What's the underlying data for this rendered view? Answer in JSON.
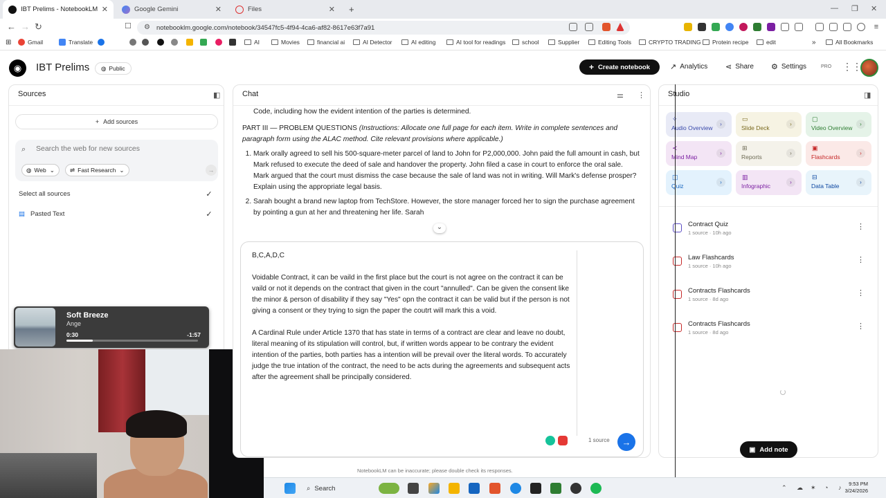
{
  "browser": {
    "tabs": [
      {
        "title": "IBT Prelims - NotebookLM",
        "active": true
      },
      {
        "title": "Google Gemini",
        "active": false
      },
      {
        "title": "Files",
        "active": false
      }
    ],
    "new_tab": "+",
    "url": "notebooklm.google.com/notebook/34547fc5-4f94-4ca6-af82-8617e63f7a91"
  },
  "bookmarks": {
    "items": [
      "Gmail",
      "Translate",
      "AI",
      "Movies",
      "financial ai",
      "AI Detector",
      "AI editing",
      "AI tool for readings",
      "school",
      "Supplier",
      "Editing Tools",
      "CRYPTO TRADING",
      "Protein recipe",
      "edit"
    ],
    "more": "»",
    "all": "All Bookmarks"
  },
  "header": {
    "notebook_title": "IBT Prelims",
    "public_label": "Public",
    "create_label": "Create notebook",
    "analytics_label": "Analytics",
    "share_label": "Share",
    "settings_label": "Settings",
    "pro_label": "PRO"
  },
  "sources": {
    "title": "Sources",
    "add_label": "Add sources",
    "search_placeholder": "Search the web for new sources",
    "web_chip": "Web",
    "research_chip": "Fast Research",
    "select_all": "Select all sources",
    "items": [
      {
        "label": "Pasted Text"
      }
    ]
  },
  "media": {
    "title": "Soft Breeze",
    "artist": "Ange",
    "current": "0:30",
    "remaining": "-1:57",
    "progress": 0.2
  },
  "chat": {
    "title": "Chat",
    "line0": "Code, including how the evident intention of the parties is determined.",
    "part3_heading": "PART III — PROBLEM QUESTIONS",
    "part3_instructions": "(Instructions: Allocate one full page for each item. Write in complete sentences and paragraph form using the ALAC method. Cite relevant provisions where applicable.)",
    "questions": [
      "Mark orally agreed to sell his 500-square-meter parcel of land to John for P2,000,000. John paid the full amount in cash, but Mark refused to execute the deed of sale and handover the property. John filed a case in court to enforce the oral sale. Mark argued that the court must dismiss the case because the sale of land was not in writing. Will Mark's defense prosper? Explain using the appropriate legal basis.",
      "Sarah bought a brand new laptop from TechStore. However, the store manager forced her to sign the purchase agreement by pointing a gun at her and threatening her life. Sarah"
    ],
    "composer_text": "B,C,A,D,C\n\nVoidable Contract, it can be vaild in the first place but the court is not agree on the contract it can be vaild or not it depends on the contract that given in the court \"annulled\". Can be given the consent like the minor & person of disability if they say \"Yes\" opn the contract it can be valid but if the person is not giving a consent or they trying to sign the paper the coutrt will mark this a void.\n\nA Cardinal Rule under Article 1370 that has state in terms of a contract are clear and leave no doubt, literal meaning of its stipulation will control, but, if written words appear to be contrary the evident intention of the parties, both parties has a intention will be prevail over the literal words. To accurately judge the true intation of the contract, the need to be acts during the agreements and subsequent acts after the agreement shall be principally considered.",
    "source_count": "1 source",
    "disclaimer": "NotebookLM can be inaccurate; please double check its responses."
  },
  "studio": {
    "title": "Studio",
    "tiles": [
      {
        "label": "Audio Overview",
        "bg": "#e8eaf6",
        "fg": "#3949ab"
      },
      {
        "label": "Slide Deck",
        "bg": "#f6f3e3",
        "fg": "#7a6a1f"
      },
      {
        "label": "Video Overview",
        "bg": "#e5f3e8",
        "fg": "#2e7d32"
      },
      {
        "label": "Mind Map",
        "bg": "#f3e5f5",
        "fg": "#7b1fa2"
      },
      {
        "label": "Reports",
        "bg": "#f4f2ea",
        "fg": "#6d6a55"
      },
      {
        "label": "Flashcards",
        "bg": "#fbe9e7",
        "fg": "#c62828"
      },
      {
        "label": "Quiz",
        "bg": "#e3f2fd",
        "fg": "#1565c0"
      },
      {
        "label": "Infographic",
        "bg": "#f3e5f5",
        "fg": "#7b1fa2"
      },
      {
        "label": "Data Table",
        "bg": "#e8f4fb",
        "fg": "#0d47a1"
      }
    ],
    "items": [
      {
        "title": "Contract Quiz",
        "meta": "1 source · 10h ago"
      },
      {
        "title": "Law Flashcards",
        "meta": "1 source · 10h ago"
      },
      {
        "title": "Contracts Flashcards",
        "meta": "1 source · 8d ago"
      },
      {
        "title": "Contracts Flashcards",
        "meta": "1 source · 8d ago"
      }
    ],
    "add_note": "Add note"
  },
  "taskbar": {
    "search": "Search",
    "time": "9:53 PM",
    "date": "3/24/2026"
  }
}
